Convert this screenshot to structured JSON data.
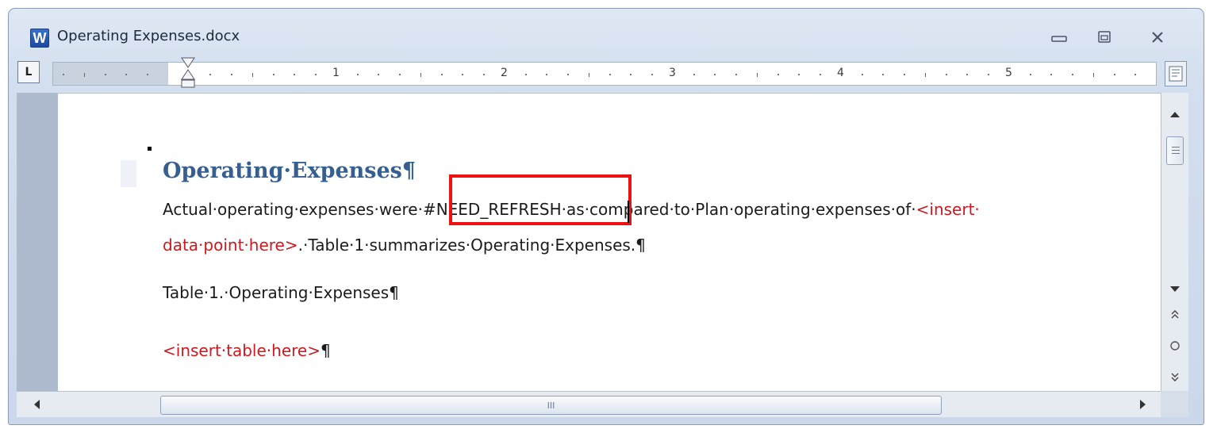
{
  "window": {
    "title": "Operating Expenses.docx",
    "app_icon_letter": "W"
  },
  "ruler": {
    "tab_selector": "L",
    "numbers": [
      "1",
      "2",
      "3",
      "4",
      "5"
    ]
  },
  "document": {
    "heading": "Operating·Expenses¶",
    "line1_part1": "Actual·operating·expenses·were·",
    "line1_field": "#NEED_REFRESH",
    "line1_part2": "·as·compared·to·Plan·operating·expenses·of·",
    "line1_placeholder": "<insert·",
    "line2_placeholder": "data·point·here>",
    "line2_rest": ".·Table·1·summarizes·Operating·Expenses.¶",
    "table_caption": "Table·1.·Operating·Expenses¶",
    "table_placeholder": "<insert·table·here>",
    "table_placeholder_mark": "¶"
  },
  "scrollbars": {
    "thumb_grip": "III"
  },
  "colors": {
    "heading": "#365f91",
    "placeholder_red": "#d0171d",
    "highlight_box": "#ee1111"
  }
}
